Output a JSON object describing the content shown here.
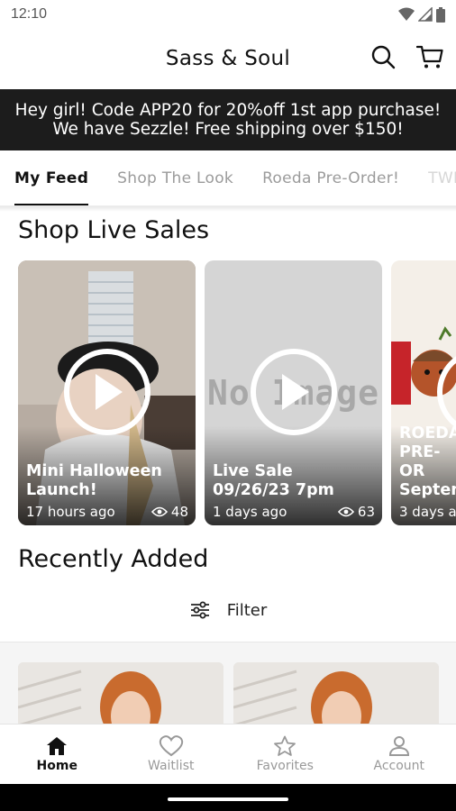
{
  "status_bar": {
    "time": "12:10"
  },
  "header": {
    "title": "Sass & Soul",
    "search_icon": "search-icon",
    "cart_icon": "cart-icon"
  },
  "promo": {
    "line1": "Hey girl! Code APP20 for 20%off 1st app purchase!",
    "line2": "We have Sezzle! Free shipping over $150!"
  },
  "tabs": [
    {
      "label": "My Feed",
      "active": true
    },
    {
      "label": "Shop The Look",
      "active": false
    },
    {
      "label": "Roeda Pre-Order!",
      "active": false
    },
    {
      "label": "TWI",
      "active": false
    }
  ],
  "live_sales": {
    "title": "Shop Live Sales",
    "cards": [
      {
        "title": "Mini Halloween Launch!",
        "time": "17 hours ago",
        "views": "48"
      },
      {
        "title": "Live Sale 09/26/23 7pm",
        "time": "1 days ago",
        "views": "63",
        "placeholder_text": "No Image"
      },
      {
        "title": "ROEDA PRE-OR Septem",
        "time": "3 days a"
      }
    ]
  },
  "recently_added": {
    "title": "Recently Added",
    "filter_label": "Filter"
  },
  "bottom_nav": [
    {
      "label": "Home",
      "icon": "home-icon",
      "active": true
    },
    {
      "label": "Waitlist",
      "icon": "heart-icon",
      "active": false
    },
    {
      "label": "Favorites",
      "icon": "star-icon",
      "active": false
    },
    {
      "label": "Account",
      "icon": "account-icon",
      "active": false
    }
  ],
  "colors": {
    "banner_bg": "#1c1c1c",
    "accent": "#111111",
    "inactive": "#999999"
  }
}
